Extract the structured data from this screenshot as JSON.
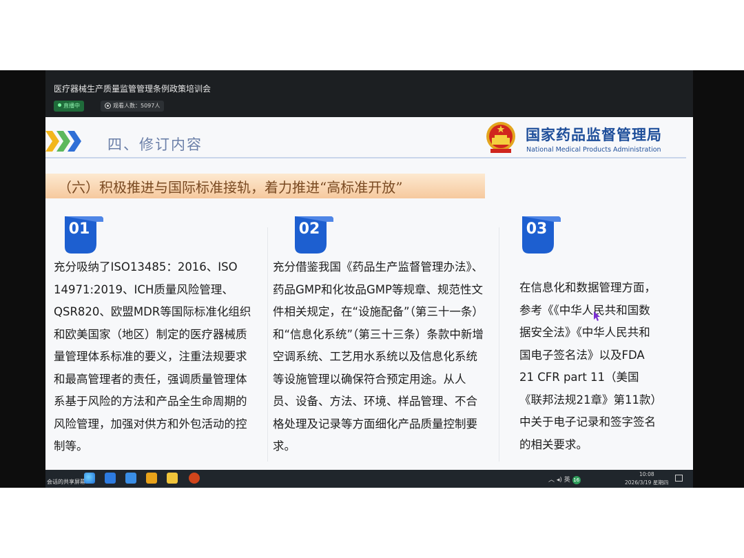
{
  "stream": {
    "title": "医疗器械生产质量监管管理条例政策培训会",
    "live_label": "直播中",
    "viewers_label": "观看人数：5097人"
  },
  "slide": {
    "section_title": "四、修订内容",
    "agency_cn": "国家药品监督管理局",
    "agency_en": "National Medical Products Administration",
    "banner": "（六）积极推进与国际标准接轨，着力推进“高标准开放”",
    "columns": [
      {
        "number": "01",
        "text": "充分吸纳了ISO13485：2016、ISO 14971:2019、ICH质量风险管理、QSR820、欧盟MDR等国际标准化组织和欧美国家（地区）制定的医疗器械质量管理体系标准的要义，注重法规要求和最高管理者的责任，强调质量管理体系基于风险的方法和产品全生命周期的风险管理，加强对供方和外包活动的控制等。"
      },
      {
        "number": "02",
        "text": "充分借鉴我国《药品生产监督管理办法》、药品GMP和化妆品GMP等规章、规范性文件相关规定，在“设施配备”（第三十一条）和“信息化系统”（第三十三条）条款中新增空调系统、工艺用水系统以及信息化系统等设施管理以确保符合预定用途。从人员、设备、方法、环境、样品管理、不合格处理及记录等方面细化产品质量控制要求。"
      },
      {
        "number": "03",
        "text": "在信息化和数据管理方面，参考《《中华人民共和国数据安全法》《中华人民共和国电子签名法》以及FDA 21 CFR part 11（美国《联邦法规21章》第11款）中关于电子记录和签字签名的相关要求。"
      }
    ]
  },
  "taskbar": {
    "share_label": "会话的共享屏幕",
    "tray_lang": "英",
    "tray_badge": "16",
    "time": "10:08",
    "date": "2026/3/19 星期四"
  },
  "colors": {
    "brand_blue": "#1e4e9a",
    "badge_blue": "#1d5fd0",
    "banner_orange": "#f6c99e"
  }
}
